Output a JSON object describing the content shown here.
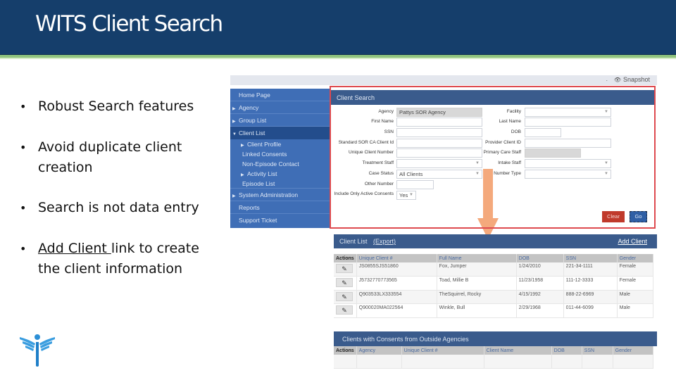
{
  "slide": {
    "title": "WITS Client Search",
    "bullets": [
      {
        "text": "Robust Search features"
      },
      {
        "text": "Avoid duplicate client creation"
      },
      {
        "text": "Search is not data entry"
      },
      {
        "link": "Add Client ",
        "text": "link to create the client information"
      }
    ],
    "colors": {
      "header": "#153e6b",
      "stripe": "#8fc37e",
      "highlight_border": "#de4a4f",
      "arrow": "#f4a97c"
    }
  },
  "app": {
    "topbar": {
      "separator": ".",
      "snapshot_label": "Snapshot"
    },
    "sidebar": {
      "items": [
        {
          "label": "Home Page"
        },
        {
          "label": "Agency"
        },
        {
          "label": "Group List"
        },
        {
          "label": "Client List"
        },
        {
          "label": "Client Profile"
        },
        {
          "label": "Linked Consents"
        },
        {
          "label": "Non-Episode Contact"
        },
        {
          "label": "Activity List"
        },
        {
          "label": "Episode List"
        },
        {
          "label": "System Administration"
        },
        {
          "label": "Reports"
        },
        {
          "label": "Support Ticket"
        }
      ]
    },
    "search": {
      "title": "Client Search",
      "left_fields": [
        {
          "label": "Agency",
          "value": "Pattys SOR Agency"
        },
        {
          "label": "First Name",
          "value": ""
        },
        {
          "label": "SSN",
          "value": ""
        },
        {
          "label": "Standard SOR CA Client Id",
          "value": ""
        },
        {
          "label": "Unique Client Number",
          "value": ""
        },
        {
          "label": "Treatment Staff",
          "value": ""
        },
        {
          "label": "Case Status",
          "value": "All Clients"
        },
        {
          "label": "Other Number",
          "value": ""
        },
        {
          "label": "Include Only Active Consents",
          "value": "Yes"
        }
      ],
      "right_fields": [
        {
          "label": "Facility",
          "value": ""
        },
        {
          "label": "Last Name",
          "value": ""
        },
        {
          "label": "DOB",
          "value": ""
        },
        {
          "label": "Provider Client ID",
          "value": ""
        },
        {
          "label": "Primary Care Staff",
          "value": ""
        },
        {
          "label": "Intake Staff",
          "value": ""
        },
        {
          "label": "Number Type",
          "value": ""
        }
      ],
      "clear_label": "Clear",
      "go_label": "Go"
    },
    "client_list": {
      "title": "Client List",
      "export_label": "(Export)",
      "add_label": "Add Client",
      "columns": [
        "Actions",
        "Unique Client #",
        "Full Name",
        "DOB",
        "SSN",
        "Gender"
      ],
      "rows": [
        {
          "id": "JS0855SJS51860",
          "name": "Fox, Jumper",
          "dob": "1/24/2010",
          "ssn": "221-34-1111",
          "gender": "Female"
        },
        {
          "id": "J5732770773565",
          "name": "Toad, Millie B",
          "dob": "11/23/1958",
          "ssn": "111-12-3333",
          "gender": "Female"
        },
        {
          "id": "Q903533LX333554",
          "name": "TheSquirrel, Rocky",
          "dob": "4/15/1992",
          "ssn": "888-22-6969",
          "gender": "Male"
        },
        {
          "id": "Q900020MA022564",
          "name": "Winkle, Bull",
          "dob": "2/29/1968",
          "ssn": "011-44-6099",
          "gender": "Male"
        }
      ]
    },
    "consents": {
      "title": "Clients with Consents from Outside Agencies",
      "columns": [
        "Actions",
        "Agency",
        "Unique Client #",
        "Client Name",
        "DOB",
        "SSN",
        "Gender"
      ]
    }
  }
}
